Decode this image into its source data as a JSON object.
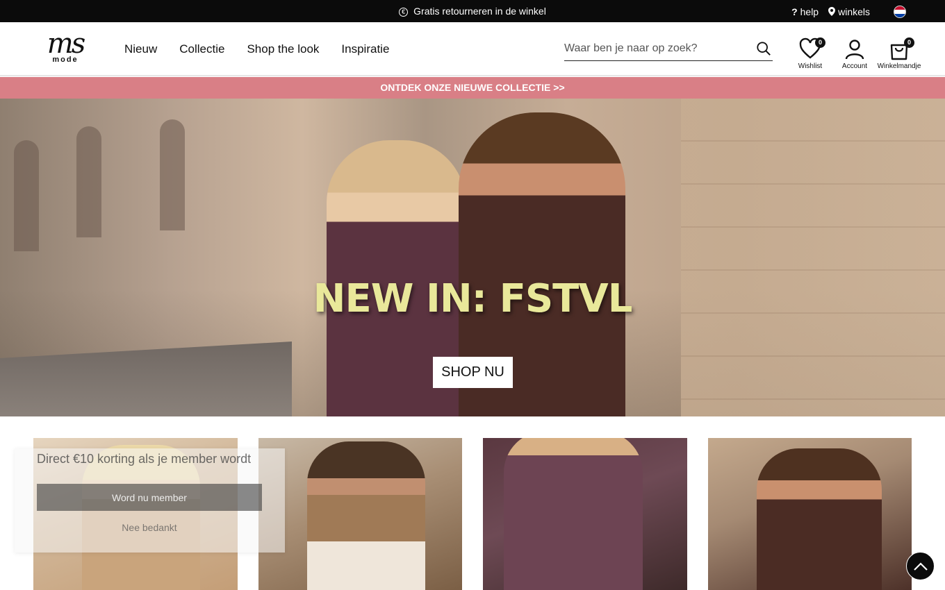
{
  "topbar": {
    "promo_text": "Gratis retourneren in de winkel",
    "help_label": "help",
    "stores_label": "winkels"
  },
  "header": {
    "logo_text": "ms",
    "logo_subtext": "mode",
    "nav": [
      "Nieuw",
      "Collectie",
      "Shop the look",
      "Inspiratie"
    ],
    "search_placeholder": "Waar ben je naar op zoek?",
    "wishlist_label": "Wishlist",
    "wishlist_count": "0",
    "account_label": "Account",
    "cart_label": "Winkelmandje",
    "cart_count": "0"
  },
  "promo_strip": {
    "text": "ONTDEK ONZE NIEUWE COLLECTIE >>"
  },
  "hero": {
    "title": "NEW IN: FSTVL",
    "button_label": "SHOP NU"
  },
  "popup": {
    "title": "Direct €10 korting als je member wordt",
    "button_label": "Word nu member",
    "dismiss_label": "Nee bedankt"
  },
  "colors": {
    "topbar_bg": "#0b0b0b",
    "promo_bg": "#d97f86",
    "hero_title": "#e9e89a"
  }
}
